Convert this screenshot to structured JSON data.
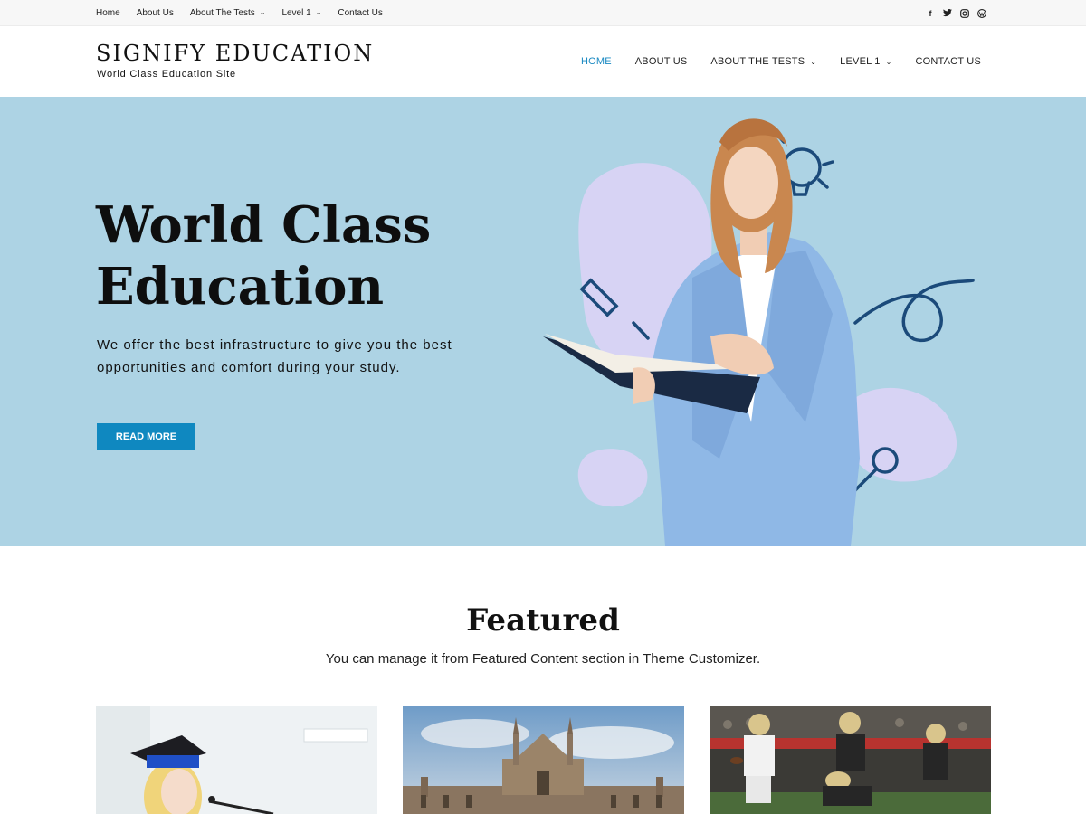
{
  "topbar": {
    "nav": [
      {
        "label": "Home",
        "dropdown": false
      },
      {
        "label": "About Us",
        "dropdown": false
      },
      {
        "label": "About The Tests",
        "dropdown": true
      },
      {
        "label": "Level 1",
        "dropdown": true
      },
      {
        "label": "Contact Us",
        "dropdown": false
      }
    ],
    "social_icons": [
      "facebook-icon",
      "twitter-icon",
      "instagram-icon",
      "wordpress-icon"
    ]
  },
  "header": {
    "site_title": "SIGNIFY EDUCATION",
    "site_tagline": "World Class Education Site",
    "nav": [
      {
        "label": "HOME",
        "active": true,
        "dropdown": false
      },
      {
        "label": "ABOUT US",
        "active": false,
        "dropdown": false
      },
      {
        "label": "ABOUT THE TESTS",
        "active": false,
        "dropdown": true
      },
      {
        "label": "LEVEL 1",
        "active": false,
        "dropdown": true
      },
      {
        "label": "CONTACT US",
        "active": false,
        "dropdown": false
      }
    ]
  },
  "hero": {
    "title_line1": "World Class",
    "title_line2": "Education",
    "text": "We offer the best infrastructure to give you the best opportunities and comfort during your study.",
    "button_label": "READ MORE",
    "background_color": "#add3e4",
    "accent_color": "#0f88c0"
  },
  "featured": {
    "title": "Featured",
    "subtitle": "You can manage it from Featured Content section in Theme Customizer.",
    "cards": [
      {
        "image": "graduate-with-microphone"
      },
      {
        "image": "gothic-college-building"
      },
      {
        "image": "football-players"
      }
    ]
  }
}
